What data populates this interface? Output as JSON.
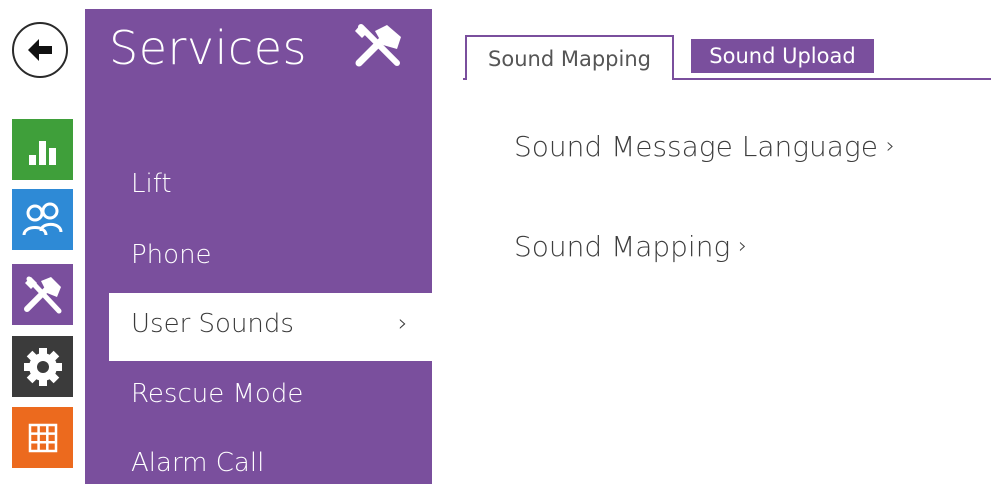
{
  "sidebar": {
    "title": "Services",
    "items": [
      {
        "label": "Lift"
      },
      {
        "label": "Phone"
      },
      {
        "label": "User Sounds",
        "chevron": "›"
      },
      {
        "label": "Rescue Mode"
      },
      {
        "label": "Alarm Call"
      }
    ]
  },
  "rail": {
    "icons": [
      "back-arrow-icon",
      "status-chart-icon",
      "directory-users-icon",
      "services-tools-icon",
      "settings-gear-icon",
      "system-grid-icon"
    ]
  },
  "tabs": [
    {
      "label": "Sound Mapping",
      "active": true
    },
    {
      "label": "Sound Upload",
      "active": false
    }
  ],
  "content": {
    "links": [
      {
        "label": "Sound Message Language",
        "chevron": "›"
      },
      {
        "label": "Sound Mapping",
        "chevron": "›"
      }
    ]
  },
  "colors": {
    "accent": "#7a4f9d",
    "status": "#3f9f3a",
    "directory": "#2e8ad6",
    "settings": "#3b3b3b",
    "system": "#ec6a1e"
  }
}
